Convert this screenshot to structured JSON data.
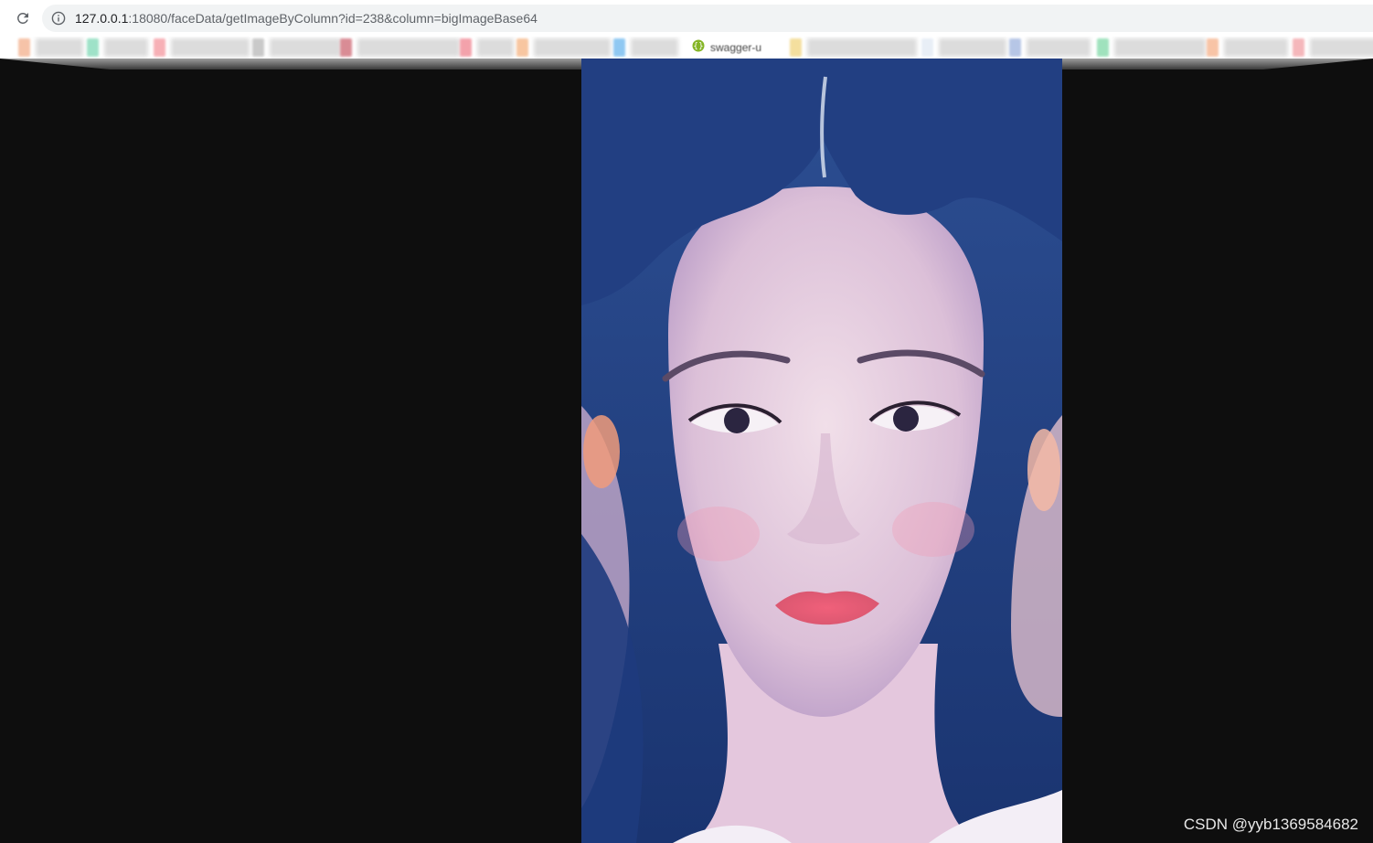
{
  "browser": {
    "url_host": "127.0.0.1",
    "url_rest": ":18080/faceData/getImageByColumn?id=238&column=bigImageBase64",
    "reload_icon": "reload-icon",
    "info_icon": "info-icon"
  },
  "bookmarks": {
    "swagger_label": "swagger-u"
  },
  "page": {
    "image_icon": "portrait-photo"
  },
  "watermark": {
    "text": "CSDN @yyb1369584682"
  }
}
